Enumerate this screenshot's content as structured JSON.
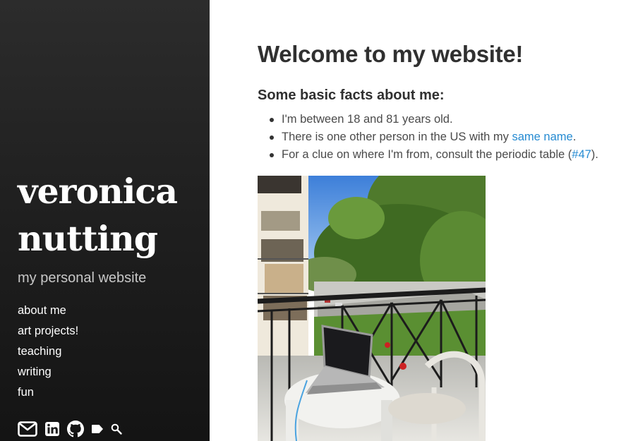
{
  "sidebar": {
    "title_line1": "veronica",
    "title_line2": "nutting",
    "tagline": "my personal website",
    "nav": [
      {
        "label": "about me"
      },
      {
        "label": "art projects!"
      },
      {
        "label": "teaching"
      },
      {
        "label": "writing"
      },
      {
        "label": "fun"
      }
    ],
    "social_icons": [
      "email-icon",
      "linkedin-icon",
      "github-icon",
      "tag-icon",
      "search-icon"
    ]
  },
  "main": {
    "title": "Welcome to my website!",
    "facts_heading": "Some basic facts about me:",
    "facts": [
      {
        "text": "I'm between 18 and 81 years old."
      },
      {
        "text_before": "There is one other person in the US with my ",
        "link": "same name",
        "text_after": "."
      },
      {
        "text_before": "For a clue on where I'm from, consult the periodic table (",
        "link": "#47",
        "text_after": ")."
      }
    ]
  },
  "colors": {
    "sidebar_background": "#202020",
    "link": "#268bd2",
    "heading": "#303030",
    "body_text": "#4a4a4a"
  }
}
